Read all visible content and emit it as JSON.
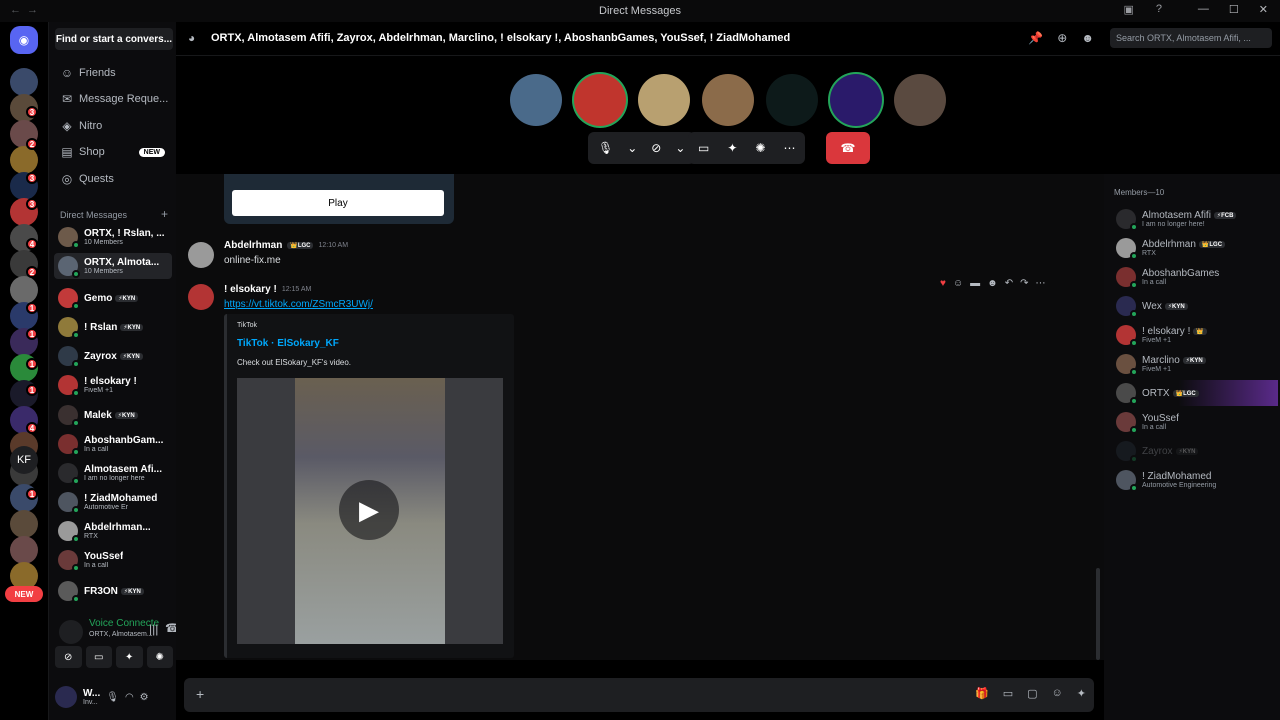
{
  "titlebar": {
    "title": "Direct Messages"
  },
  "guild_badges": [
    "3",
    "2",
    "3",
    "3",
    "4",
    "2",
    "1",
    "1",
    "1",
    "1",
    "4",
    "1"
  ],
  "new_pill": "NEW",
  "dm_sidebar": {
    "search": "Find or start a convers...",
    "nav": [
      {
        "label": "Friends",
        "icon": "friends-icon"
      },
      {
        "label": "Message Reque...",
        "icon": "message-request-icon"
      },
      {
        "label": "Nitro",
        "icon": "nitro-icon"
      },
      {
        "label": "Shop",
        "icon": "shop-icon",
        "badge": "NEW"
      },
      {
        "label": "Quests",
        "icon": "quests-icon"
      }
    ],
    "dm_header": "Direct Messages",
    "dm_add": "+",
    "items": [
      {
        "name": "ORTX, ! Rslan, ...",
        "sub": "10 Members",
        "color": "#6d5a4a"
      },
      {
        "name": "ORTX, Almota...",
        "sub": "10 Members",
        "color": "#5b6573"
      },
      {
        "name": "Gemo",
        "tag": "⚡KYN",
        "sub": "",
        "color": "#c23a3a"
      },
      {
        "name": "! Rslan",
        "tag": "⚡KYN",
        "sub": "",
        "color": "#8f7a3a"
      },
      {
        "name": "Zayrox",
        "tag": "⚡KYN",
        "sub": "",
        "color": "#2f3a48"
      },
      {
        "name": "! elsokary !",
        "tag": "",
        "sub": "FiveM +1",
        "color": "#b33434"
      },
      {
        "name": "Malek",
        "tag": "⚡KYN",
        "sub": "",
        "color": "#3a3030"
      },
      {
        "name": "AboshanbGam...",
        "tag": "",
        "sub": "In a call",
        "color": "#7a2f2f"
      },
      {
        "name": "Almotasem Afi...",
        "tag": "",
        "sub": "I am no longer here",
        "color": "#2a2a2d"
      },
      {
        "name": "! ZiadMohamed",
        "tag": "",
        "sub": "Automotive Er",
        "color": "#4e5560"
      },
      {
        "name": "Abdelrhman...",
        "tag": "",
        "sub": "RTX",
        "color": "#9a9a9a"
      },
      {
        "name": "YouSsef",
        "tag": "",
        "sub": "In a call",
        "color": "#6a3a3a"
      },
      {
        "name": "FR3ON",
        "tag": "⚡KYN",
        "sub": "",
        "color": "#5a5a5a"
      }
    ],
    "voice": {
      "status": "Voice Connecte",
      "channel": "ORTX, Almotasem..."
    },
    "user": {
      "name": "W...",
      "status": "Inv..."
    }
  },
  "header": {
    "title": "ORTX, Almotasem Afifi, Zayrox, Abdelrhman, Marclino, ! elsokary !, AboshanbGames, YouSsef, ! ZiadMohamed",
    "search_placeholder": "Search ORTX, Almotasem Afifi, ..."
  },
  "call": {
    "avatars": [
      "#4a6a8a",
      "#c0352d",
      "#b8a070",
      "#8b6b4a",
      "#0d1a1a",
      "#2a1a6a",
      "#5a4a40"
    ]
  },
  "chat": {
    "play_label": "Play",
    "messages": [
      {
        "author": "Abdelrhman",
        "tag": "👑LGC",
        "time": "12:10 AM",
        "text": "online-fix.me"
      },
      {
        "author": "! elsokary !",
        "time": "12:15 AM",
        "link": "https://vt.tiktok.com/ZSmcR3UWj/"
      }
    ],
    "embed": {
      "provider": "TikTok",
      "title": "TikTok · ElSokary_KF",
      "description": "Check out ElSokary_KF's video."
    }
  },
  "members": {
    "header": "Members—10",
    "list": [
      {
        "name": "Almotasem Afifi",
        "tag": "⚡FCB",
        "sub": "I am no longer here!",
        "color": "#2a2a2d"
      },
      {
        "name": "Abdelrhman",
        "tag": "👑LGC",
        "sub": "RTX",
        "color": "#9a9a9a"
      },
      {
        "name": "AboshanbGames",
        "tag": "",
        "sub": "In a call",
        "color": "#7a2f2f"
      },
      {
        "name": "Wex",
        "tag": "⚡KYN",
        "sub": "",
        "color": "#2a2a50"
      },
      {
        "name": "! elsokary !",
        "tag": "👑",
        "sub": "FiveM +1",
        "color": "#b33434"
      },
      {
        "name": "Marclino",
        "tag": "⚡KYN",
        "sub": "FiveM +1",
        "color": "#6a5040"
      },
      {
        "name": "ORTX",
        "tag": "👑LGC",
        "sub": "",
        "color": "#4a4a4a"
      },
      {
        "name": "YouSsef",
        "tag": "",
        "sub": "In a call",
        "color": "#6a3a3a"
      },
      {
        "name": "Zayrox",
        "tag": "⚡KYN",
        "sub": "",
        "color": "#2f3a48"
      },
      {
        "name": "! ZiadMohamed",
        "tag": "",
        "sub": "Automotive Engineering",
        "color": "#4e5560"
      }
    ]
  }
}
